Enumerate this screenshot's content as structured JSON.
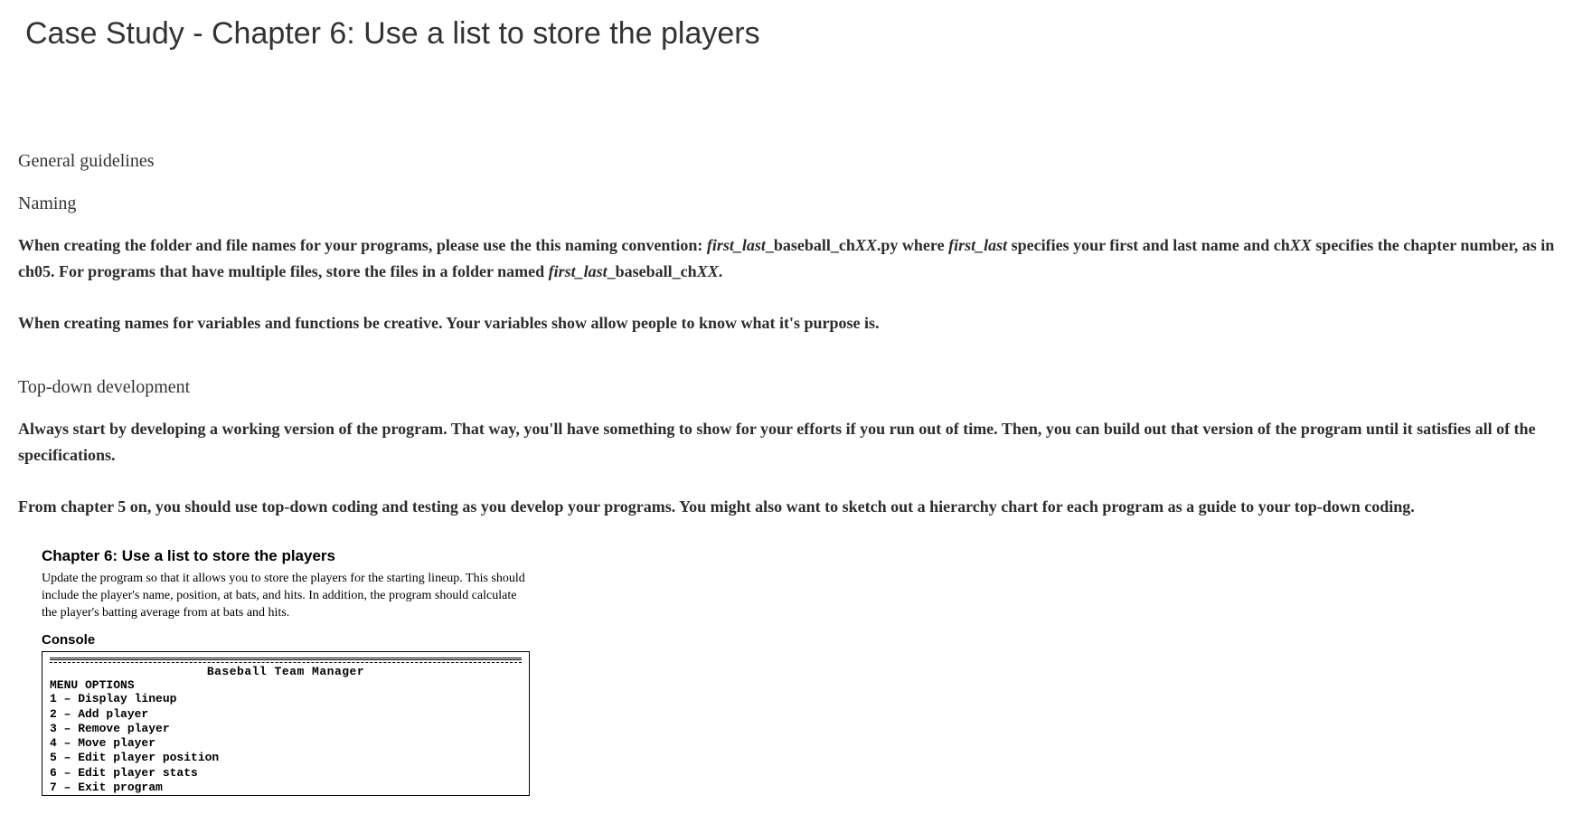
{
  "page": {
    "title": "Case Study - Chapter 6: Use a list to store the players"
  },
  "guidelines": {
    "heading": "General guidelines",
    "naming": {
      "heading": "Naming",
      "para1_prefix": "When creating the folder and file names for your programs, please use the this naming convention: ",
      "para1_em1": "first_last",
      "para1_mid1": "_baseball_ch",
      "para1_em2": "XX",
      "para1_mid2": ".py where ",
      "para1_em3": "first_last",
      "para1_mid3": " specifies your first and last name and ch",
      "para1_em4": "XX",
      "para1_mid4": " specifies the chapter number, as in ch05. For programs that have multiple files, store the files in a folder named ",
      "para1_em5": "first_last",
      "para1_mid5": "_baseball_ch",
      "para1_em6": "XX",
      "para1_suffix": ".",
      "para2": "When creating names for variables and functions be creative. Your variables show allow people to know what it's purpose is."
    },
    "topdown": {
      "heading": "Top-down development",
      "para1": "Always start by developing a working version of the program. That way, you'll have something to show for your efforts if you run out of time. Then, you can build out that version of the program until it satisfies all of the specifications.",
      "para2": "From chapter 5 on, you should use top-down coding and testing as you develop your programs. You might also want to sketch out a hierarchy chart for each program as a guide to your top-down coding."
    }
  },
  "assignment": {
    "title": "Chapter 6: Use a list to store the players",
    "description": "Update the program so that it allows you to store the players for the starting lineup. This should include the player's name, position, at bats, and hits. In addition, the program should calculate the player's batting average from at bats and hits.",
    "console_label": "Console",
    "console": {
      "banner": "Baseball Team Manager",
      "menu_label": "MENU OPTIONS",
      "items": [
        "1 – Display lineup",
        "2 – Add player",
        "3 – Remove player",
        "4 – Move player",
        "5 – Edit player position",
        "6 – Edit player stats",
        "7 – Exit program"
      ]
    }
  }
}
